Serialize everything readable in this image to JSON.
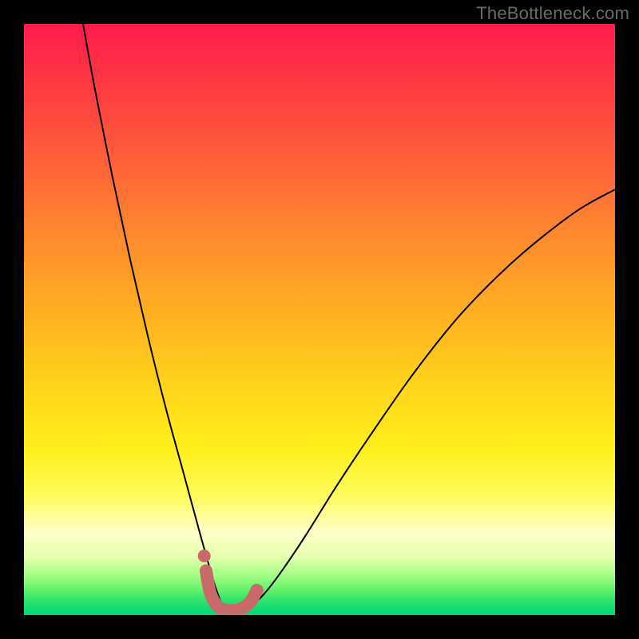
{
  "watermark": "TheBottleneck.com",
  "chart_data": {
    "type": "line",
    "title": "",
    "xlabel": "",
    "ylabel": "",
    "xlim": [
      0,
      100
    ],
    "ylim": [
      0,
      100
    ],
    "grid": false,
    "series": [
      {
        "name": "bottleneck-curve",
        "x": [
          10,
          12,
          15,
          18,
          21,
          24,
          27,
          30,
          32,
          33,
          34,
          35,
          37,
          39,
          41,
          44,
          48,
          53,
          59,
          66,
          74,
          83,
          93,
          100
        ],
        "y": [
          100,
          89,
          74,
          60,
          47,
          35,
          24,
          13,
          6,
          3,
          1,
          1,
          1,
          2,
          4,
          8,
          14,
          22,
          31,
          41,
          51,
          60,
          68,
          72
        ],
        "color": "#000000",
        "stroke_width": 2
      },
      {
        "name": "highlight-valley",
        "x": [
          30.8,
          31.5,
          32.5,
          33.5,
          34.5,
          35.5,
          36.5,
          37.5,
          38.5,
          39.4
        ],
        "y": [
          7.5,
          3.8,
          1.8,
          1.0,
          0.8,
          0.8,
          1.0,
          1.5,
          2.5,
          4.2
        ],
        "color": "#C96A6A",
        "stroke_width": 16
      }
    ],
    "points": [
      {
        "name": "marker-dot",
        "x": 30.5,
        "y": 10.0,
        "r": 8,
        "color": "#C96A6A"
      }
    ]
  }
}
